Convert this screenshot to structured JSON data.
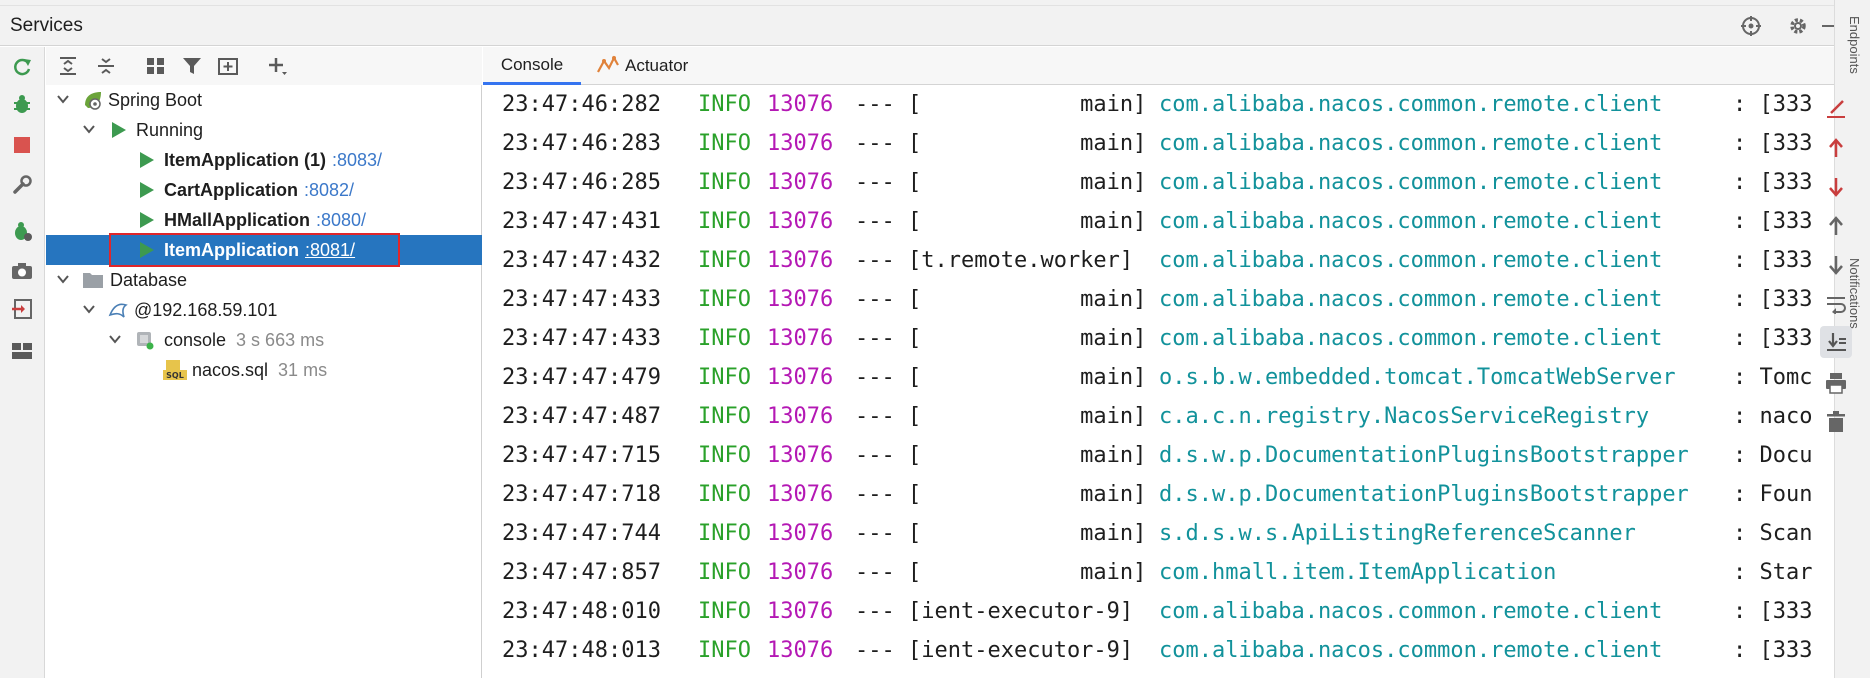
{
  "panel": {
    "title": "Services"
  },
  "right_strip": {
    "label_top": "Endpoints",
    "label_bottom": "Notifications"
  },
  "tree": {
    "spring_boot": "Spring Boot",
    "running": "Running",
    "apps": [
      {
        "name": "ItemApplication (1)",
        "port": ":8083/"
      },
      {
        "name": "CartApplication",
        "port": ":8082/"
      },
      {
        "name": "HMallApplication",
        "port": ":8080/"
      },
      {
        "name": "ItemApplication",
        "port": ":8081/"
      }
    ],
    "database": "Database",
    "host": "@192.168.59.101",
    "session": {
      "name": "console",
      "time": "3 s 663 ms"
    },
    "file": {
      "name": "nacos.sql",
      "time": "31 ms"
    }
  },
  "tabs": [
    {
      "label": "Console"
    },
    {
      "label": "Actuator"
    }
  ],
  "log": [
    {
      "time": "23:47:46:282",
      "level": "INFO",
      "pid": "13076",
      "sep": "---",
      "thread": "[            main]",
      "logger": "com.alibaba.nacos.common.remote.client",
      "msg": ": [333"
    },
    {
      "time": "23:47:46:283",
      "level": "INFO",
      "pid": "13076",
      "sep": "---",
      "thread": "[            main]",
      "logger": "com.alibaba.nacos.common.remote.client",
      "msg": ": [333"
    },
    {
      "time": "23:47:46:285",
      "level": "INFO",
      "pid": "13076",
      "sep": "---",
      "thread": "[            main]",
      "logger": "com.alibaba.nacos.common.remote.client",
      "msg": ": [333"
    },
    {
      "time": "23:47:47:431",
      "level": "INFO",
      "pid": "13076",
      "sep": "---",
      "thread": "[            main]",
      "logger": "com.alibaba.nacos.common.remote.client",
      "msg": ": [333"
    },
    {
      "time": "23:47:47:432",
      "level": "INFO",
      "pid": "13076",
      "sep": "---",
      "thread": "[t.remote.worker]",
      "logger": "com.alibaba.nacos.common.remote.client",
      "msg": ": [333"
    },
    {
      "time": "23:47:47:433",
      "level": "INFO",
      "pid": "13076",
      "sep": "---",
      "thread": "[            main]",
      "logger": "com.alibaba.nacos.common.remote.client",
      "msg": ": [333"
    },
    {
      "time": "23:47:47:433",
      "level": "INFO",
      "pid": "13076",
      "sep": "---",
      "thread": "[            main]",
      "logger": "com.alibaba.nacos.common.remote.client",
      "msg": ": [333"
    },
    {
      "time": "23:47:47:479",
      "level": "INFO",
      "pid": "13076",
      "sep": "---",
      "thread": "[            main]",
      "logger": "o.s.b.w.embedded.tomcat.TomcatWebServer",
      "msg": ": Tomc"
    },
    {
      "time": "23:47:47:487",
      "level": "INFO",
      "pid": "13076",
      "sep": "---",
      "thread": "[            main]",
      "logger": "c.a.c.n.registry.NacosServiceRegistry",
      "msg": ": naco"
    },
    {
      "time": "23:47:47:715",
      "level": "INFO",
      "pid": "13076",
      "sep": "---",
      "thread": "[            main]",
      "logger": "d.s.w.p.DocumentationPluginsBootstrapper",
      "msg": ": Docu"
    },
    {
      "time": "23:47:47:718",
      "level": "INFO",
      "pid": "13076",
      "sep": "---",
      "thread": "[            main]",
      "logger": "d.s.w.p.DocumentationPluginsBootstrapper",
      "msg": ": Foun"
    },
    {
      "time": "23:47:47:744",
      "level": "INFO",
      "pid": "13076",
      "sep": "---",
      "thread": "[            main]",
      "logger": "s.d.s.w.s.ApiListingReferenceScanner",
      "msg": ": Scan"
    },
    {
      "time": "23:47:47:857",
      "level": "INFO",
      "pid": "13076",
      "sep": "---",
      "thread": "[            main]",
      "logger": "com.hmall.item.ItemApplication",
      "msg": ": Star"
    },
    {
      "time": "23:47:48:010",
      "level": "INFO",
      "pid": "13076",
      "sep": "---",
      "thread": "[ient-executor-9]",
      "logger": "com.alibaba.nacos.common.remote.client",
      "msg": ": [333"
    },
    {
      "time": "23:47:48:013",
      "level": "INFO",
      "pid": "13076",
      "sep": "---",
      "thread": "[ient-executor-9]",
      "logger": "com.alibaba.nacos.common.remote.client",
      "msg": ": [333"
    }
  ],
  "colors": {
    "selection": "#2675bf",
    "log_level": "#2aa12a",
    "log_pid": "#b418b4",
    "log_logger": "#12929b",
    "port_link": "#3b78c9",
    "highlight_box": "#e0262a",
    "run_green": "#3d9a50"
  }
}
